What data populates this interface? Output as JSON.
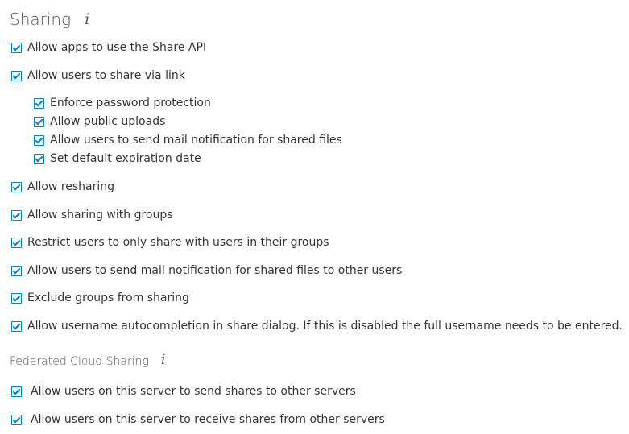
{
  "sharing": {
    "title": "Sharing",
    "info_glyph": "i",
    "options": [
      {
        "label": "Allow apps to use the Share API",
        "checked": true
      },
      {
        "label": "Allow users to share via link",
        "checked": true
      },
      {
        "label": "Enforce password protection",
        "checked": true
      },
      {
        "label": "Allow public uploads",
        "checked": true
      },
      {
        "label": "Allow users to send mail notification for shared files",
        "checked": true
      },
      {
        "label": "Set default expiration date",
        "checked": true
      },
      {
        "label": "Allow resharing",
        "checked": true
      },
      {
        "label": "Allow sharing with groups",
        "checked": true
      },
      {
        "label": "Restrict users to only share with users in their groups",
        "checked": true
      },
      {
        "label": "Allow users to send mail notification for shared files to other users",
        "checked": true
      },
      {
        "label": "Exclude groups from sharing",
        "checked": true
      },
      {
        "label": "Allow username autocompletion in share dialog. If this is disabled the full username needs to be entered.",
        "checked": true
      }
    ]
  },
  "federated": {
    "title": "Federated Cloud Sharing",
    "info_glyph": "i",
    "options": [
      {
        "label": "Allow users on this server to send shares to other servers",
        "checked": true
      },
      {
        "label": "Allow users on this server to receive shares from other servers",
        "checked": true
      }
    ]
  },
  "colors": {
    "accent": "#0082c9",
    "text": "#333333",
    "heading": "#555555"
  }
}
